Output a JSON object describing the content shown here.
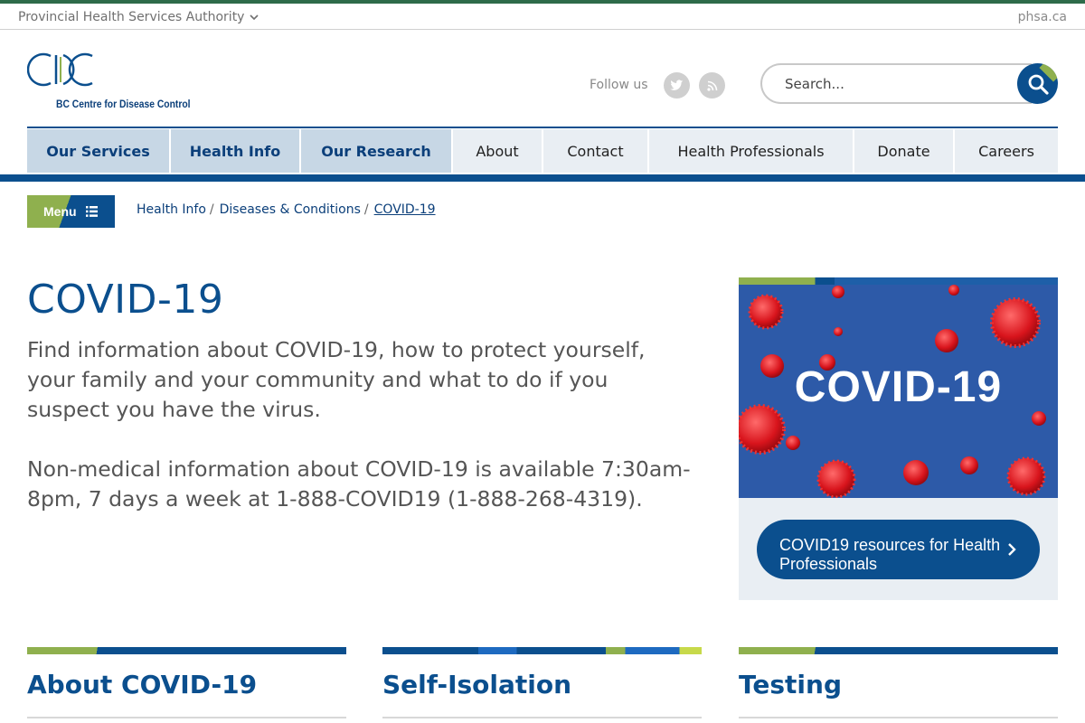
{
  "topbar": {
    "org_label": "Provincial Health Services Authority",
    "site_link": "phsa.ca"
  },
  "header": {
    "logo_subtitle": "BC Centre for Disease Control",
    "follow_label": "Follow us",
    "social": [
      "twitter-icon",
      "rss-icon"
    ],
    "search_placeholder": "Search..."
  },
  "nav": {
    "items": [
      {
        "label": "Our Services"
      },
      {
        "label": "Health Info"
      },
      {
        "label": "Our Research"
      },
      {
        "label": "About"
      },
      {
        "label": "Contact"
      },
      {
        "label": "Health Professionals"
      },
      {
        "label": "Donate"
      },
      {
        "label": "Careers"
      }
    ]
  },
  "menu_label": "Menu",
  "breadcrumb": {
    "items": [
      "Health Info",
      "Diseases & Conditions",
      "COVID-19"
    ],
    "separator": "/"
  },
  "main": {
    "title": "COVID-19",
    "paragraph1": "Find information about COVID-19, how to protect yourself, your family and your community and what to do if you suspect you have the virus.",
    "paragraph2": "Non-medical information about COVID-19 is available 7:30am-8pm, 7 days a week at 1-888-COVID19 (1-888-268-4319)."
  },
  "side": {
    "banner_text": "COVID-19",
    "button_label": "COVID19 resources for Health Professionals"
  },
  "cards": [
    {
      "title": "About COVID-19"
    },
    {
      "title": "Self-Isolation"
    },
    {
      "title": "Testing"
    }
  ],
  "colors": {
    "primary": "#0b4f8e",
    "accent_green": "#8fb04e",
    "nav_primary_bg": "#c7d7e5",
    "nav_bg": "#e9eef3"
  }
}
